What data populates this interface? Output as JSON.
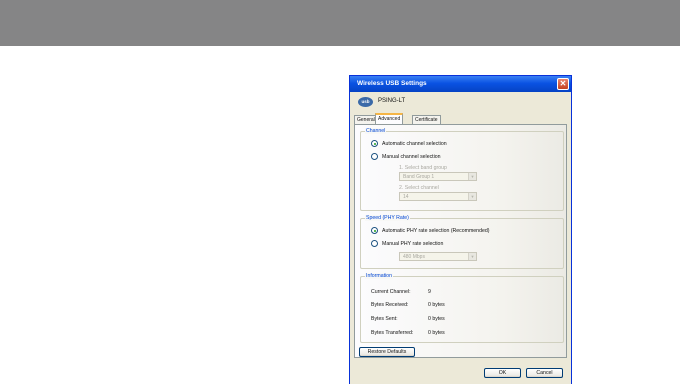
{
  "window": {
    "title": "Wireless USB Settings",
    "close_label": "✕"
  },
  "header": {
    "logo_text": "usb",
    "device_name": "PSING-LT"
  },
  "tabs": [
    {
      "label": "General"
    },
    {
      "label": "Advanced"
    },
    {
      "label": "Certificate"
    }
  ],
  "channel": {
    "title": "Channel",
    "auto_label": "Automatic channel selection",
    "manual_label": "Manual channel selection",
    "band_label": "1. Select band group",
    "band_value": "Band Group 1",
    "channel_label": "2. Select channel",
    "channel_value": "14"
  },
  "speed": {
    "title": "Speed (PHY Rate)",
    "auto_label": "Automatic PHY rate selection (Recommended)",
    "manual_label": "Manual PHY rate selection",
    "rate_value": "480 Mbps"
  },
  "information": {
    "title": "Information",
    "rows": [
      {
        "label": "Current Channel:",
        "value": "9"
      },
      {
        "label": "Bytes Received:",
        "value": "0 bytes"
      },
      {
        "label": "Bytes Sent:",
        "value": "0 bytes"
      },
      {
        "label": "Bytes Transferred:",
        "value": "0 bytes"
      }
    ]
  },
  "buttons": {
    "restore": "Restore Defaults",
    "ok": "OK",
    "cancel": "Cancel"
  }
}
